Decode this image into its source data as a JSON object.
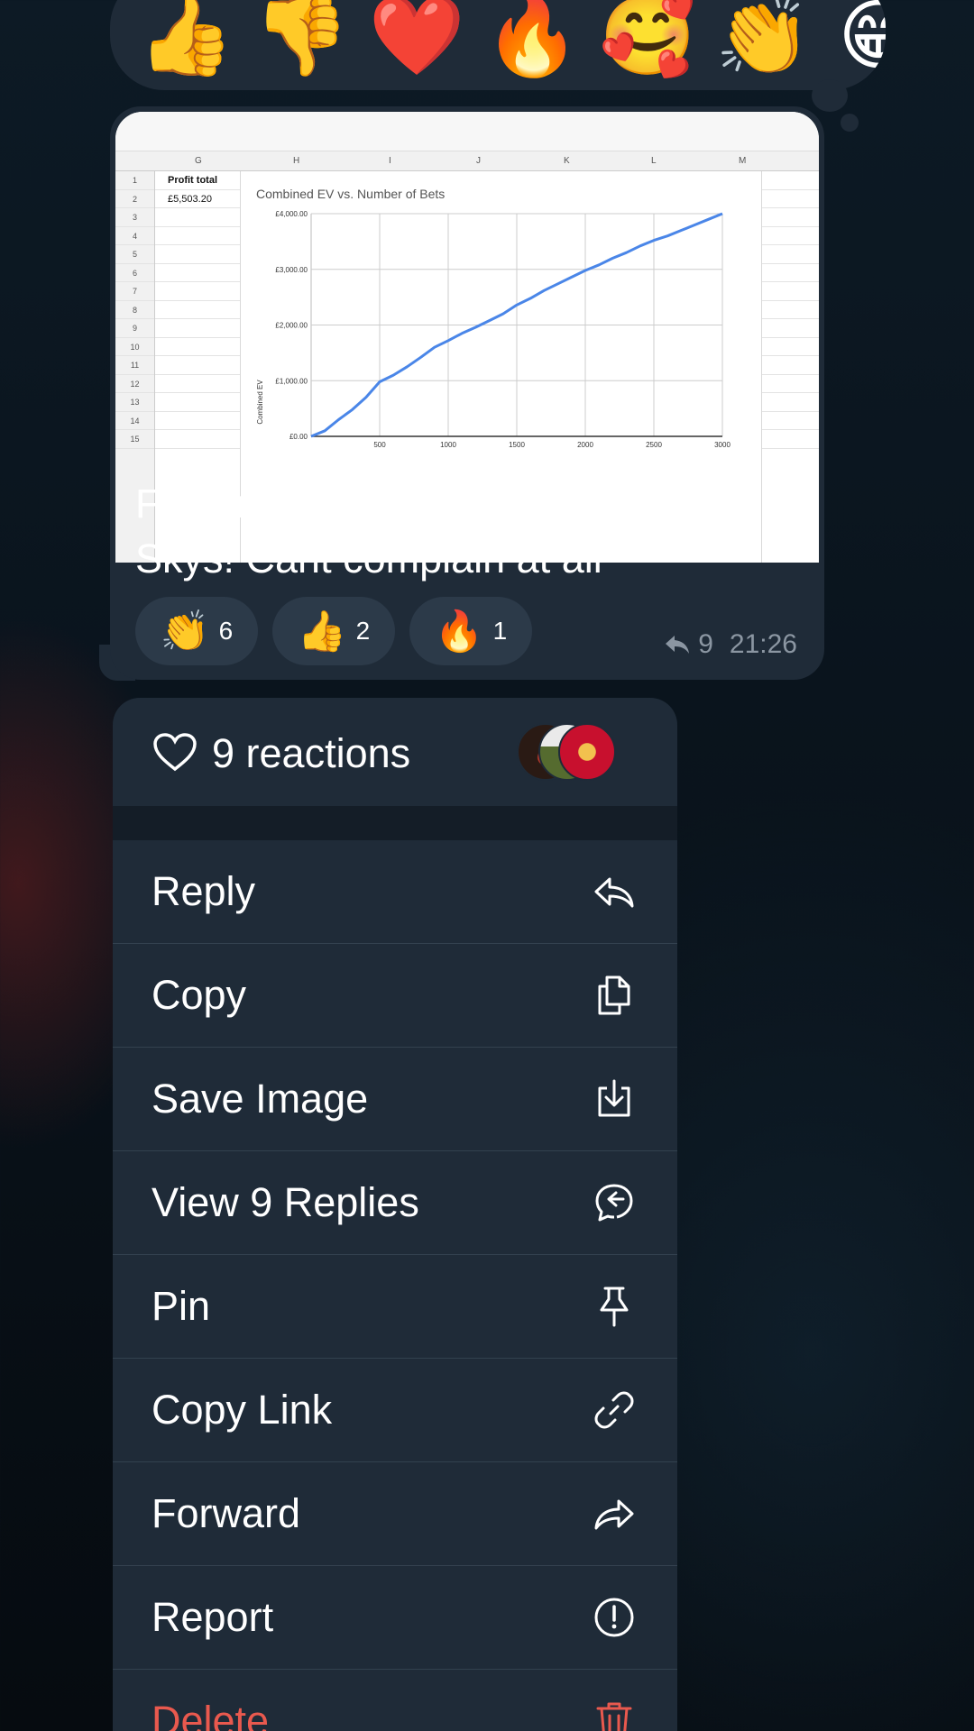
{
  "reaction_picker": {
    "emojis": [
      "👍",
      "👎",
      "❤️",
      "🔥",
      "🥰",
      "👏",
      "😁"
    ]
  },
  "message": {
    "image": {
      "column_headers": [
        "G",
        "H",
        "I",
        "J",
        "K",
        "L",
        "M"
      ],
      "row_numbers": [
        "1",
        "2",
        "3",
        "4",
        "5",
        "6",
        "7",
        "8",
        "9",
        "10",
        "11",
        "12",
        "13",
        "14",
        "15"
      ],
      "cell_g1": "Profit total",
      "cell_g2": "£5,503.20"
    },
    "text_line1": "Full month doing the restricted",
    "text_line2": "Skys! Cant complain at all",
    "reactions": [
      {
        "emoji": "👏",
        "count": "6"
      },
      {
        "emoji": "👍",
        "count": "2"
      },
      {
        "emoji": "🔥",
        "count": "1"
      }
    ],
    "replies_count": "9",
    "time": "21:26"
  },
  "chart_data": {
    "type": "line",
    "title": "Combined EV vs. Number of Bets",
    "xlabel": "",
    "ylabel": "Combined EV",
    "xlim": [
      0,
      3000
    ],
    "ylim": [
      0,
      4000
    ],
    "x_ticks": [
      "500",
      "1000",
      "1500",
      "2000",
      "2500",
      "3000"
    ],
    "y_ticks": [
      "£0.00",
      "£1,000.00",
      "£2,000.00",
      "£3,000.00",
      "£4,000.00"
    ],
    "grid": true,
    "series": [
      {
        "color": "#4a86e8",
        "x": [
          0,
          100,
          200,
          300,
          400,
          500,
          600,
          700,
          800,
          900,
          1000,
          1100,
          1200,
          1300,
          1400,
          1500,
          1600,
          1700,
          1800,
          1900,
          2000,
          2100,
          2200,
          2300,
          2400,
          2500,
          2600,
          2700,
          2800,
          2900,
          3000
        ],
        "y": [
          0,
          100,
          300,
          480,
          700,
          980,
          1100,
          1250,
          1420,
          1600,
          1720,
          1850,
          1960,
          2080,
          2200,
          2360,
          2480,
          2620,
          2740,
          2860,
          2980,
          3080,
          3200,
          3300,
          3420,
          3520,
          3600,
          3700,
          3800,
          3900,
          4000
        ]
      }
    ]
  },
  "reactions_header": {
    "label": "9 reactions"
  },
  "menu": {
    "items": [
      {
        "label": "Reply"
      },
      {
        "label": "Copy"
      },
      {
        "label": "Save Image"
      },
      {
        "label": "View 9 Replies"
      },
      {
        "label": "Pin"
      },
      {
        "label": "Copy Link"
      },
      {
        "label": "Forward"
      },
      {
        "label": "Report"
      },
      {
        "label": "Delete"
      }
    ]
  },
  "colors": {
    "danger": "#e9594e",
    "line": "#4a86e8",
    "bubble": "#1f2b38"
  }
}
